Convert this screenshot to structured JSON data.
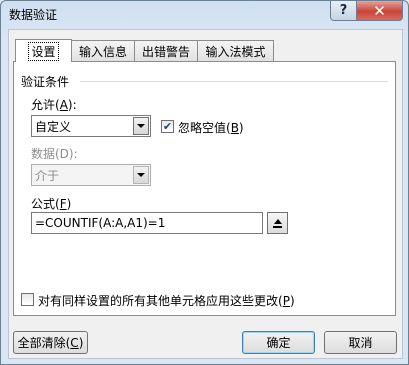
{
  "window": {
    "title": "数据验证",
    "help_label": "?",
    "close_label": "✕"
  },
  "tabs": [
    {
      "label": "设置"
    },
    {
      "label": "输入信息"
    },
    {
      "label": "出错警告"
    },
    {
      "label": "输入法模式"
    }
  ],
  "settings": {
    "section_title": "验证条件",
    "allow": {
      "label_text": "允许(",
      "label_key": "A",
      "label_tail": "):",
      "value": "自定义"
    },
    "ignore_blank": {
      "label_text": "忽略空值(",
      "label_key": "B",
      "label_tail": ")",
      "checked": true
    },
    "data": {
      "label": "数据(D):",
      "value": "介于"
    },
    "formula": {
      "label_text": "公式(",
      "label_key": "F",
      "label_tail": ")",
      "value": "=COUNTIF(A:A,A1)=1"
    },
    "apply_all": {
      "label_text": "对有同样设置的所有其他单元格应用这些更改(",
      "label_key": "P",
      "label_tail": ")",
      "checked": false
    }
  },
  "footer": {
    "clear_all_text": "全部清除(",
    "clear_all_key": "C",
    "clear_all_tail": ")",
    "ok_label": "确定",
    "cancel_label": "取消"
  }
}
